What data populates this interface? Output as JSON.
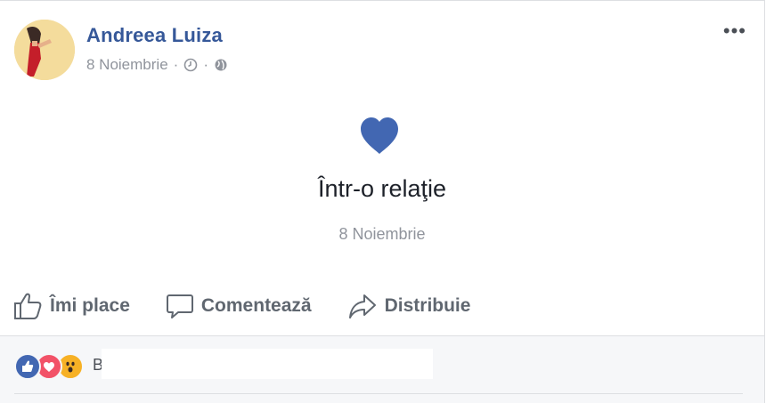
{
  "post": {
    "author": "Andreea Luiza",
    "date": "8 Noiembrie",
    "more_label": "•••"
  },
  "life_event": {
    "icon": "heart-icon",
    "title": "Într-o relaţie",
    "date": "8 Noiembrie",
    "color": "#4267b2"
  },
  "actions": {
    "like": "Îmi place",
    "comment": "Comentează",
    "share": "Distribuie"
  },
  "reactions": {
    "icons": [
      "like-reaction-icon",
      "love-reaction-icon",
      "wow-reaction-icon"
    ],
    "names": "B"
  },
  "colors": {
    "link": "#365899",
    "secondary_text": "#90949c",
    "action_text": "#606770",
    "like_blue": "#4267b2",
    "love_red": "#f25268",
    "wow_yellow": "#f7b125"
  }
}
